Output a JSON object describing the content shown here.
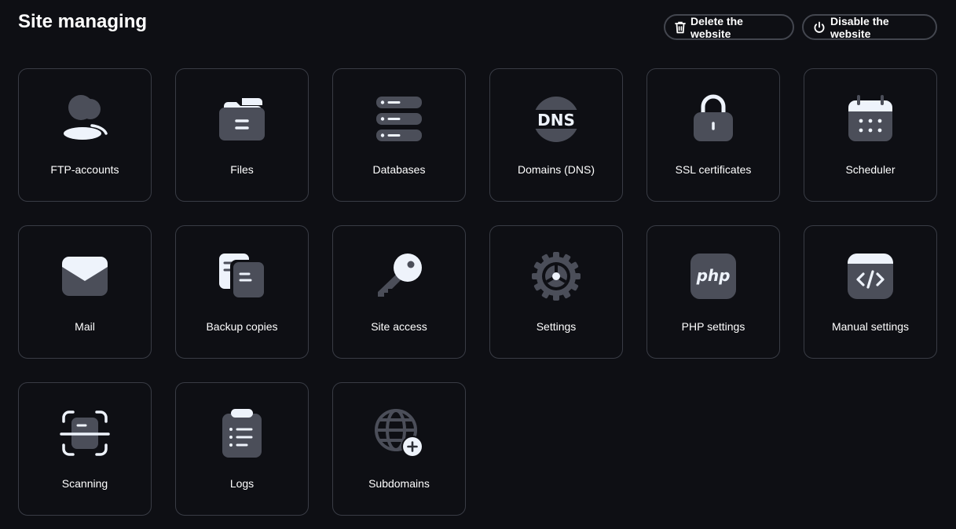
{
  "header": {
    "title": "Site managing",
    "delete_label": "Delete the website",
    "disable_label": "Disable the website"
  },
  "tiles": [
    {
      "label": "FTP-accounts",
      "icon": "users-icon"
    },
    {
      "label": "Files",
      "icon": "folder-icon"
    },
    {
      "label": "Databases",
      "icon": "database-icon"
    },
    {
      "label": "Domains (DNS)",
      "icon": "dns-icon",
      "icon_text": "DNS"
    },
    {
      "label": "SSL certificates",
      "icon": "lock-icon"
    },
    {
      "label": "Scheduler",
      "icon": "calendar-icon"
    },
    {
      "label": "Mail",
      "icon": "envelope-icon"
    },
    {
      "label": "Backup copies",
      "icon": "copies-icon"
    },
    {
      "label": "Site access",
      "icon": "key-icon"
    },
    {
      "label": "Settings",
      "icon": "gear-icon"
    },
    {
      "label": "PHP settings",
      "icon": "php-icon",
      "icon_text": "php"
    },
    {
      "label": "Manual settings",
      "icon": "code-icon"
    },
    {
      "label": "Scanning",
      "icon": "scan-icon"
    },
    {
      "label": "Logs",
      "icon": "clipboard-list-icon"
    },
    {
      "label": "Subdomains",
      "icon": "globe-plus-icon"
    }
  ],
  "colors": {
    "background": "#0e0f14",
    "tile_border": "#393c45",
    "icon_dark": "#4b4e59",
    "icon_light": "#eef3fb"
  }
}
